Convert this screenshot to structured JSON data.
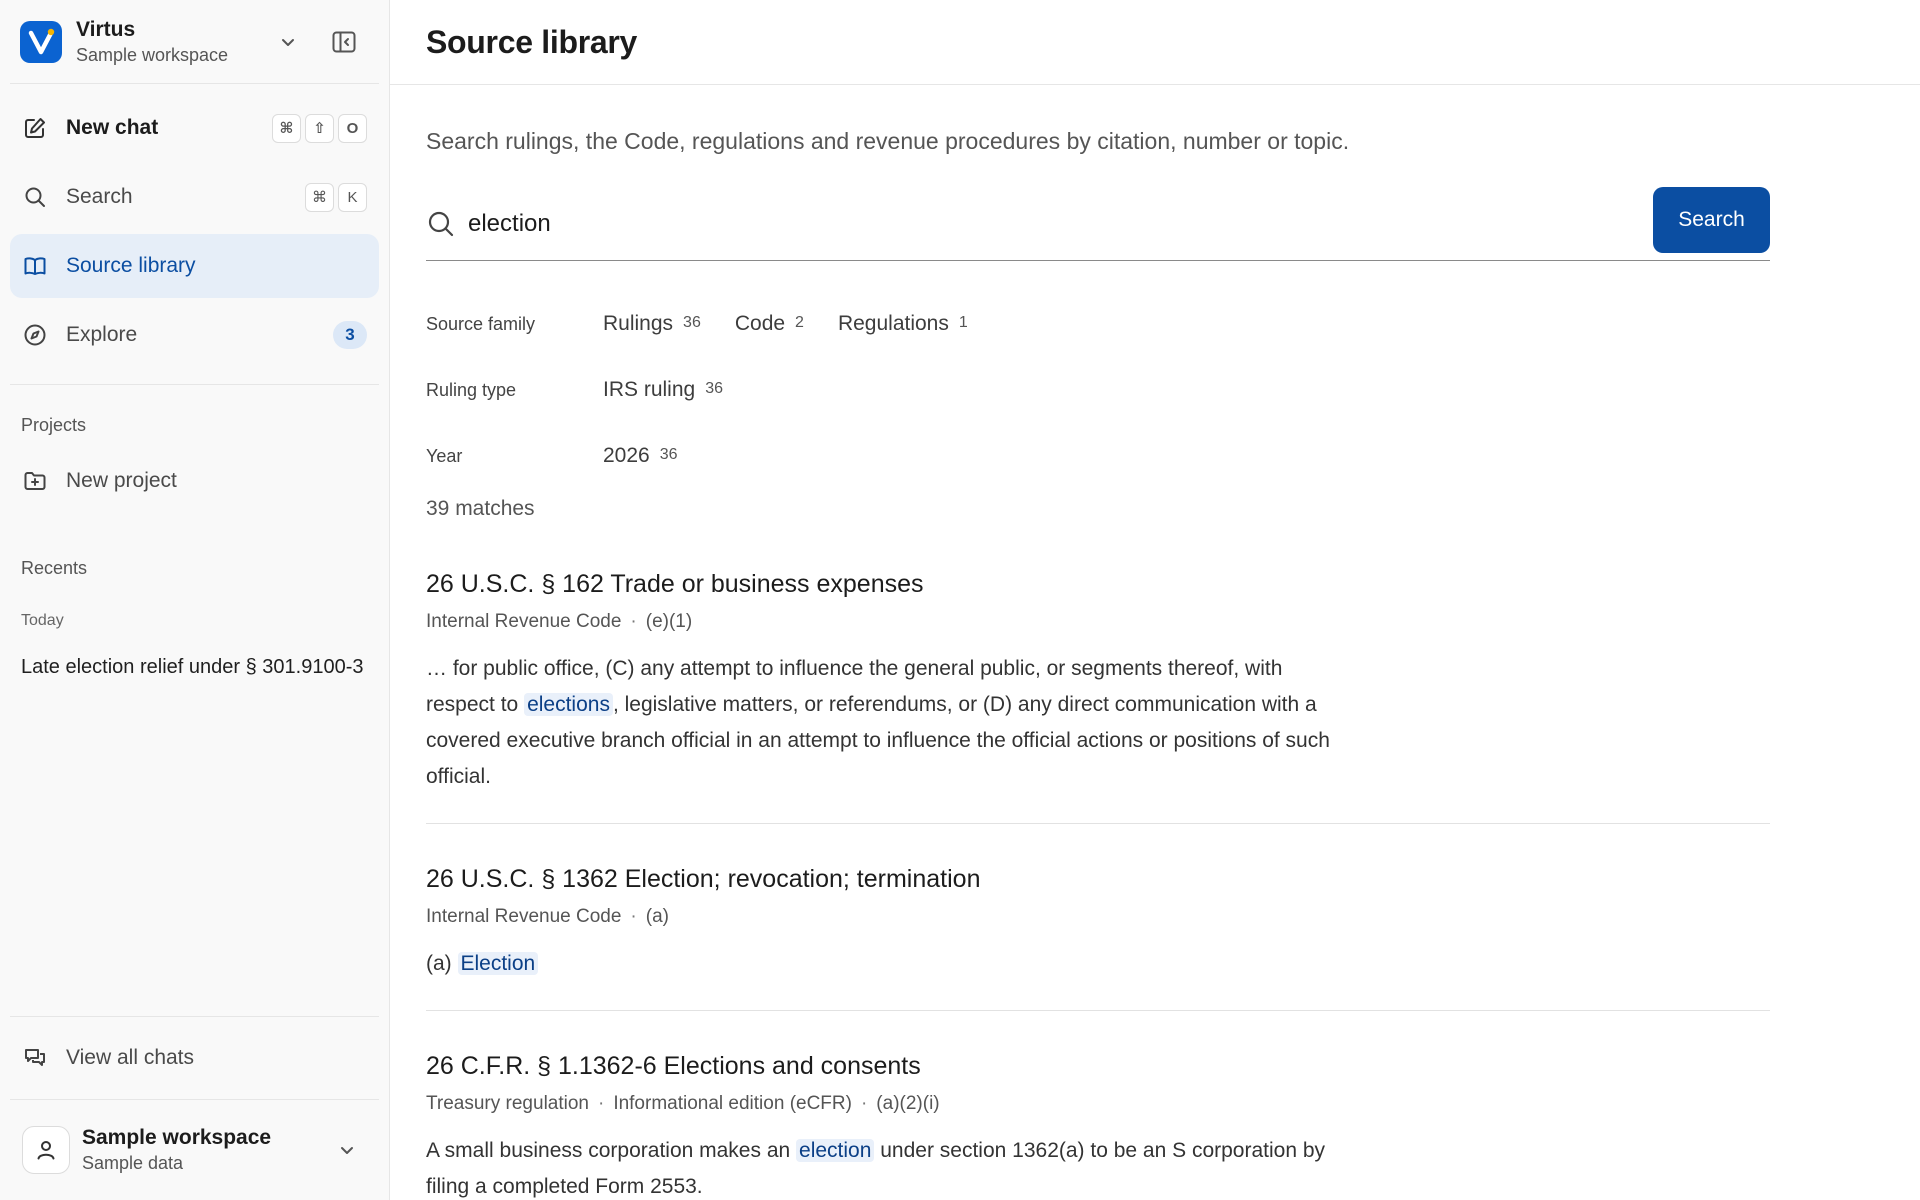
{
  "workspace": {
    "name": "Virtus",
    "subtitle": "Sample workspace"
  },
  "nav": {
    "new_chat": {
      "label": "New chat",
      "shortcut": [
        "⌘",
        "⇧",
        "O"
      ]
    },
    "search": {
      "label": "Search",
      "shortcut": [
        "⌘",
        "K"
      ]
    },
    "source_library": {
      "label": "Source library"
    },
    "explore": {
      "label": "Explore",
      "badge": "3"
    }
  },
  "projects": {
    "heading": "Projects",
    "new_project": "New project"
  },
  "recents": {
    "heading": "Recents",
    "group": "Today",
    "items": [
      "Late election relief under § 301.9100-3"
    ]
  },
  "footer": {
    "view_all": "View all chats",
    "account_name": "Sample workspace",
    "account_sub": "Sample data"
  },
  "page": {
    "title": "Source library",
    "intro": "Search rulings, the Code, regulations and revenue procedures by citation, number or topic.",
    "search_value": "election",
    "search_button": "Search",
    "matches": "39 matches"
  },
  "filters": [
    {
      "label": "Source family",
      "options": [
        {
          "label": "Rulings",
          "count": "36"
        },
        {
          "label": "Code",
          "count": "2"
        },
        {
          "label": "Regulations",
          "count": "1"
        }
      ]
    },
    {
      "label": "Ruling type",
      "options": [
        {
          "label": "IRS ruling",
          "count": "36"
        }
      ]
    },
    {
      "label": "Year",
      "options": [
        {
          "label": "2026",
          "count": "36"
        }
      ]
    }
  ],
  "results": [
    {
      "title": "26 U.S.C. § 162 Trade or business expenses",
      "meta": [
        "Internal Revenue Code",
        "(e)(1)"
      ],
      "snippet_before": "… for public office, (C) any attempt to influence the general public, or segments thereof, with respect to ",
      "snippet_highlight": "elections",
      "snippet_after": ", legislative matters, or referendums, or (D) any direct communication with a covered executive branch official in an attempt to influence the official actions or positions of such official."
    },
    {
      "title": "26 U.S.C. § 1362 Election; revocation; termination",
      "meta": [
        "Internal Revenue Code",
        "(a)"
      ],
      "snippet_before": "(a) ",
      "snippet_highlight": "Election",
      "snippet_after": ""
    },
    {
      "title": "26 C.F.R. § 1.1362-6 Elections and consents",
      "meta": [
        "Treasury regulation",
        "Informational edition (eCFR)",
        "(a)(2)(i)"
      ],
      "snippet_before": "A small business corporation makes an ",
      "snippet_highlight": "election",
      "snippet_after": " under section 1362(a) to be an S corporation by filing a completed Form 2553."
    }
  ]
}
